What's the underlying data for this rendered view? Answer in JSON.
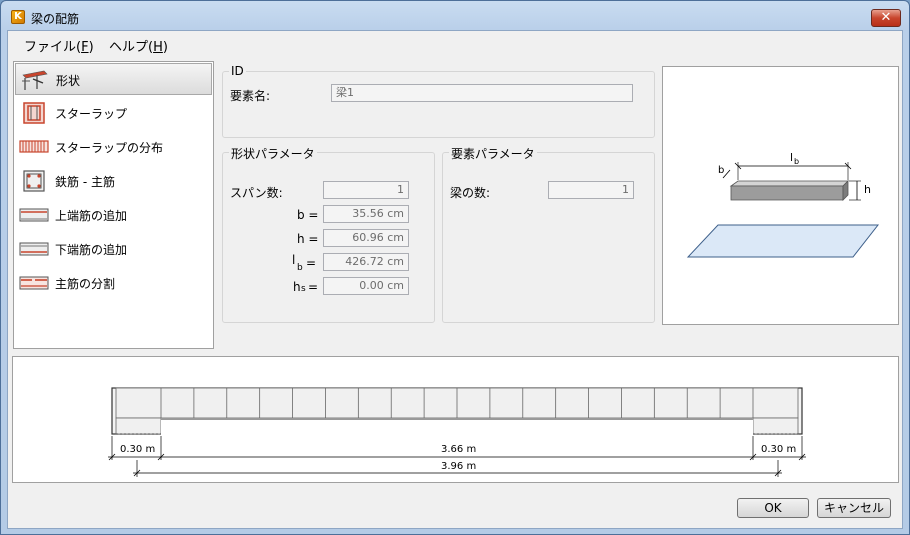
{
  "window": {
    "title": "梁の配筋",
    "close_label": "✕"
  },
  "menu": {
    "file": "ファイル(",
    "file_key": "F",
    "help": "ヘルプ(",
    "help_key": "H",
    "close_paren": ")"
  },
  "nav": {
    "items": [
      {
        "label": "形状"
      },
      {
        "label": "スターラップ"
      },
      {
        "label": "スターラップの分布"
      },
      {
        "label": "鉄筋 - 主筋"
      },
      {
        "label": "上端筋の追加"
      },
      {
        "label": "下端筋の追加"
      },
      {
        "label": "主筋の分割"
      }
    ]
  },
  "id_group": {
    "title": "ID",
    "name_label": "要素名:",
    "name_value": "梁1"
  },
  "shape_group": {
    "title": "形状パラメータ",
    "span_label": "スパン数:",
    "span_value": "1",
    "b_label": "b =",
    "b_value": "35.56 cm",
    "h_label": "h =",
    "h_value": "60.96 cm",
    "lb_label_main": "l",
    "lb_label_sub": "b",
    "lb_eq": "=",
    "lb_value": "426.72 cm",
    "hs_label_main": "h",
    "hs_label_sub": "s",
    "hs_eq": "=",
    "hs_value": "0.00 cm"
  },
  "element_group": {
    "title": "要素パラメータ",
    "count_label": "梁の数:",
    "count_value": "1"
  },
  "preview": {
    "lb_label": "l",
    "lb_sub": "b",
    "b_label": "b",
    "h_label": "h"
  },
  "elevation": {
    "left_support": "0.30 m",
    "clear_span": "3.66 m",
    "right_support": "0.30 m",
    "total": "3.96 m"
  },
  "buttons": {
    "ok": "OK",
    "cancel": "キャンセル"
  },
  "colors": {
    "accent": "#c8452d",
    "plane_fill": "#dbe8f7",
    "beam_fill": "#a8a8a8"
  }
}
